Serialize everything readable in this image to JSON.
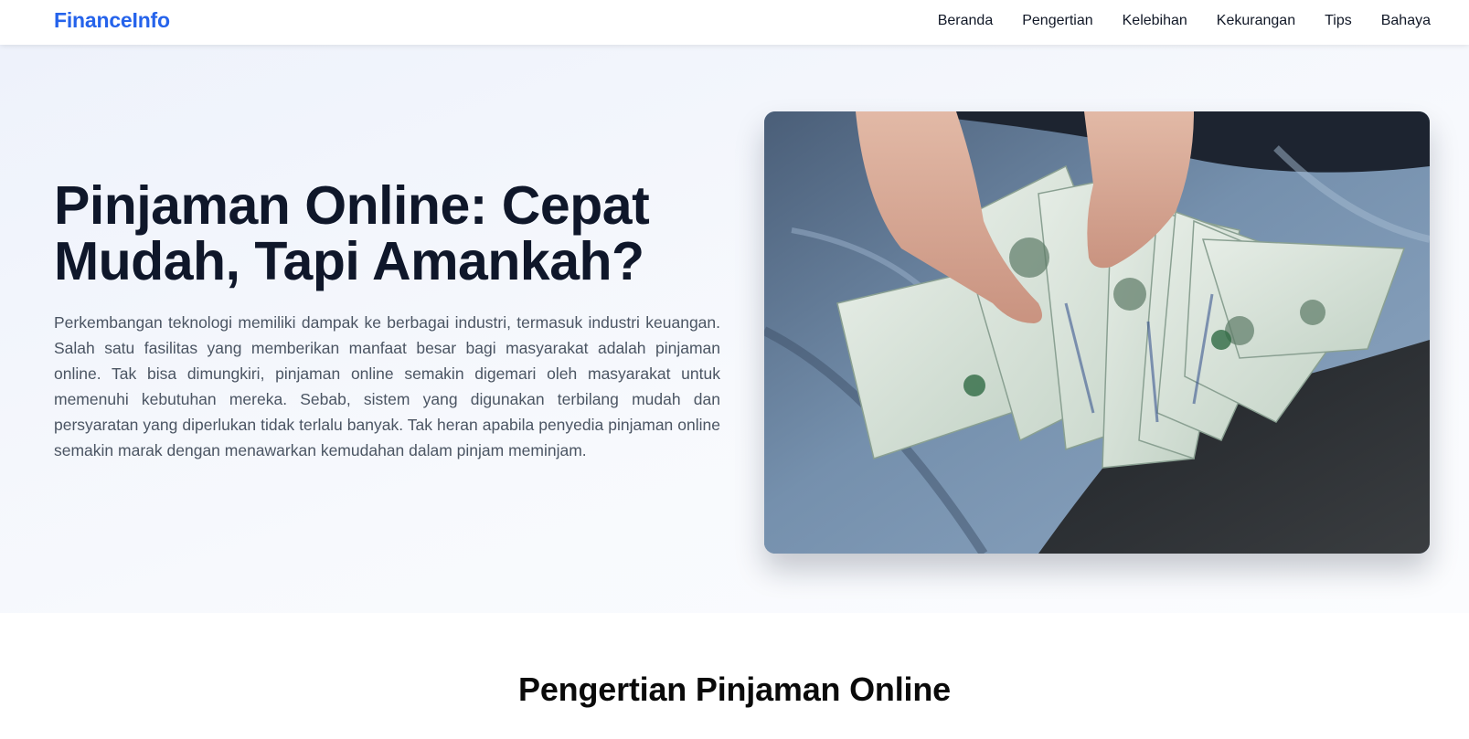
{
  "navbar": {
    "brand": "FinanceInfo",
    "links": [
      "Beranda",
      "Pengertian",
      "Kelebihan",
      "Kekurangan",
      "Tips",
      "Bahaya"
    ]
  },
  "hero": {
    "title": "Pinjaman Online: Cepat Mudah, Tapi Amankah?",
    "paragraph": "Perkembangan teknologi memiliki dampak ke berbagai industri, termasuk industri keuangan. Salah satu fasilitas yang memberikan manfaat besar bagi masyarakat adalah pinjaman online. Tak bisa dimungkiri, pinjaman online semakin digemari oleh masyarakat untuk memenuhi kebutuhan mereka. Sebab, sistem yang digunakan terbilang mudah dan persyaratan yang diperlukan tidak terlalu banyak. Tak heran apabila penyedia pinjaman online semakin marak dengan menawarkan kemudahan dalam pinjam meminjam.",
    "image_subject": "hands-holding-fanned-100-dollar-bills"
  },
  "section": {
    "title": "Pengertian Pinjaman Online"
  },
  "colors": {
    "brand": "#2563eb",
    "heading": "#0f172a",
    "body_text": "#4b5563",
    "hero_bg": "#f3f6fc"
  }
}
